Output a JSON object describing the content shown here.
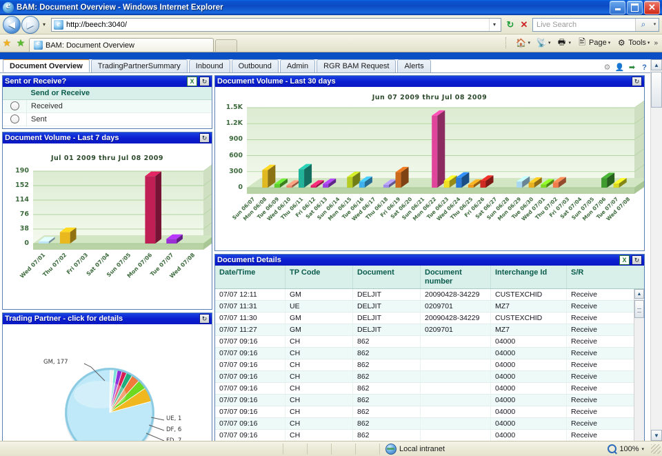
{
  "window": {
    "title": "BAM: Document Overview - Windows Internet Explorer",
    "minimize_label": "Minimize",
    "maximize_label": "Maximize",
    "close_label": "Close"
  },
  "nav": {
    "back_glyph": "◀",
    "forward_glyph": "▶",
    "history_glyph": "▾",
    "url": "http://beech:3040/",
    "addr_drop_glyph": "▾",
    "refresh_glyph": "↻",
    "stop_glyph": "✕",
    "search_placeholder": "Live Search",
    "search_glyph": "⌕",
    "search_drop_glyph": "▾"
  },
  "tabstrip": {
    "favorites_star": "★",
    "add_favorites": "★",
    "tab_label": "BAM: Document Overview",
    "new_tab_label": ""
  },
  "commandbar": {
    "home": {
      "label": "",
      "icon": "🏠",
      "arrow": "▾"
    },
    "feeds": {
      "label": "",
      "icon": "◉",
      "arrow": "▾"
    },
    "print": {
      "label": "",
      "icon": "🖨",
      "arrow": "▾"
    },
    "page": {
      "label": "Page",
      "icon": "🗎",
      "arrow": "▾"
    },
    "tools": {
      "label": "Tools",
      "icon": "⚙",
      "arrow": "▾"
    },
    "overflow": "»"
  },
  "apptabs": {
    "items": [
      {
        "label": "Document Overview",
        "active": true
      },
      {
        "label": "TradingPartnerSummary",
        "active": false
      },
      {
        "label": "Inbound",
        "active": false
      },
      {
        "label": "Outbound",
        "active": false
      },
      {
        "label": "Admin",
        "active": false
      },
      {
        "label": "RGR BAM Request",
        "active": false
      },
      {
        "label": "Alerts",
        "active": false
      }
    ],
    "tools": [
      {
        "name": "gear-icon",
        "glyph": "⚙"
      },
      {
        "name": "user-icon",
        "glyph": "👤"
      },
      {
        "name": "exit-icon",
        "glyph": "➡"
      },
      {
        "name": "help-icon",
        "glyph": "?"
      }
    ]
  },
  "panels": {
    "sent_or_receive": {
      "title": "Sent or Receive?",
      "export_glyph": "X",
      "refresh_glyph": "↻",
      "column_header": "Send or Receive",
      "options": [
        {
          "label": "Received",
          "selected": false
        },
        {
          "label": "Sent",
          "selected": false
        }
      ]
    },
    "volume_7": {
      "title": "Document Volume - Last 7 days",
      "refresh_glyph": "↻"
    },
    "volume_30": {
      "title": "Document Volume - Last 30 days",
      "refresh_glyph": "↻"
    },
    "trading_partner": {
      "title": "Trading Partner - click for details",
      "refresh_glyph": "↻"
    },
    "document_details": {
      "title": "Document Details",
      "export_glyph": "X",
      "refresh_glyph": "↻",
      "columns": [
        "Date/Time",
        "TP Code",
        "Document",
        "Document number",
        "Interchange Id",
        "S/R"
      ],
      "rows": [
        [
          "07/07 12:11",
          "GM",
          "DELJIT",
          "20090428-34229",
          "CUSTEXCHID",
          "Receive"
        ],
        [
          "07/07 11:31",
          "UE",
          "DELJIT",
          "0209701",
          "MZ7",
          "Receive"
        ],
        [
          "07/07 11:30",
          "GM",
          "DELJIT",
          "20090428-34229",
          "CUSTEXCHID",
          "Receive"
        ],
        [
          "07/07 11:27",
          "GM",
          "DELJIT",
          "0209701",
          "MZ7",
          "Receive"
        ],
        [
          "07/07 09:16",
          "CH",
          "862",
          "",
          "04000",
          "Receive"
        ],
        [
          "07/07 09:16",
          "CH",
          "862",
          "",
          "04000",
          "Receive"
        ],
        [
          "07/07 09:16",
          "CH",
          "862",
          "",
          "04000",
          "Receive"
        ],
        [
          "07/07 09:16",
          "CH",
          "862",
          "",
          "04000",
          "Receive"
        ],
        [
          "07/07 09:16",
          "CH",
          "862",
          "",
          "04000",
          "Receive"
        ],
        [
          "07/07 09:16",
          "CH",
          "862",
          "",
          "04000",
          "Receive"
        ],
        [
          "07/07 09:16",
          "CH",
          "862",
          "",
          "04000",
          "Receive"
        ],
        [
          "07/07 09:16",
          "CH",
          "862",
          "",
          "04000",
          "Receive"
        ],
        [
          "07/07 09:16",
          "CH",
          "862",
          "",
          "04000",
          "Receive"
        ]
      ],
      "scroll_up_glyph": "▲",
      "scroll_down_glyph": "▼"
    }
  },
  "chart_data": [
    {
      "id": "volume_7",
      "type": "bar",
      "title": "Jul 01 2009 thru Jul 08 2009",
      "xlabel": "",
      "ylabel": "",
      "ylim": [
        0,
        190
      ],
      "yticks": [
        0,
        38,
        76,
        114,
        152,
        190
      ],
      "grid": true,
      "legend": "none",
      "categories": [
        "Wed 07/01",
        "Thu 07/02",
        "Fri 07/03",
        "Sat 07/04",
        "Sun 07/05",
        "Mon 07/06",
        "Tue 07/07",
        "Wed 07/08"
      ],
      "values": [
        5,
        30,
        0,
        0,
        0,
        177,
        12,
        0
      ],
      "colors": [
        "#bfe4f5",
        "#e8b81e",
        "#000000",
        "#000000",
        "#000000",
        "#c01f55",
        "#9b2fd6",
        "#000000"
      ]
    },
    {
      "id": "volume_30",
      "type": "bar",
      "title": "Jun 07 2009 thru Jul 08 2009",
      "xlabel": "",
      "ylabel": "",
      "ylim": [
        0,
        1500
      ],
      "yticks": [
        0,
        300,
        600,
        900,
        1200,
        1500
      ],
      "ytick_labels": [
        "0",
        "300",
        "600",
        "900",
        "1.2K",
        "1.5K"
      ],
      "grid": true,
      "legend": "none",
      "categories": [
        "Sun 06/07",
        "Mon 06/08",
        "Tue 06/09",
        "Wed 06/10",
        "Thu 06/11",
        "Fri 06/12",
        "Sat 06/13",
        "Sun 06/14",
        "Mon 06/15",
        "Tue 06/16",
        "Wed 06/17",
        "Thu 06/18",
        "Fri 06/19",
        "Sat 06/20",
        "Sun 06/21",
        "Mon 06/22",
        "Tue 06/23",
        "Wed 06/24",
        "Thu 06/25",
        "Fri 06/26",
        "Sat 06/27",
        "Sun 06/28",
        "Mon 06/29",
        "Tue 06/30",
        "Wed 07/01",
        "Thu 07/02",
        "Fri 07/03",
        "Sat 07/04",
        "Sun 07/05",
        "Mon 07/06",
        "Tue 07/07",
        "Wed 07/08"
      ],
      "values": [
        0,
        330,
        70,
        40,
        345,
        35,
        70,
        0,
        200,
        110,
        0,
        55,
        290,
        0,
        0,
        1350,
        130,
        190,
        55,
        130,
        0,
        0,
        115,
        95,
        60,
        100,
        0,
        0,
        0,
        180,
        80,
        0
      ],
      "colors": [
        "#000000",
        "#e0b820",
        "#5ecb2e",
        "#f08a6e",
        "#22b39b",
        "#e0256b",
        "#9b3fe0",
        "#000000",
        "#b6cc22",
        "#3fb0ee",
        "#000000",
        "#9f8ce8",
        "#cc6a1e",
        "#000000",
        "#000000",
        "#e0459b",
        "#f0e024",
        "#2a7bd8",
        "#f09a1e",
        "#cc2a22",
        "#000000",
        "#000000",
        "#a8d8f0",
        "#e8b020",
        "#7cd820",
        "#f07a4a",
        "#000000",
        "#000000",
        "#000000",
        "#3f9b2e",
        "#d8d820",
        "#000000"
      ]
    },
    {
      "id": "trading_partner",
      "type": "pie",
      "title": "",
      "legend": "labels",
      "labels": [
        "GM, 177",
        "UE, 1",
        "DF, 6",
        "FD, 7"
      ],
      "slice_labels": [
        "GM",
        "UE",
        "DF",
        "FD"
      ],
      "values": [
        177,
        1,
        6,
        7
      ],
      "colors": [
        "#b8e8f8",
        "#7e1fd0",
        "#e01f5a",
        "#1fb07a"
      ]
    }
  ],
  "statusbar": {
    "zone": "Local intranet",
    "zoom": "100%",
    "zoom_drop_glyph": "▾"
  }
}
